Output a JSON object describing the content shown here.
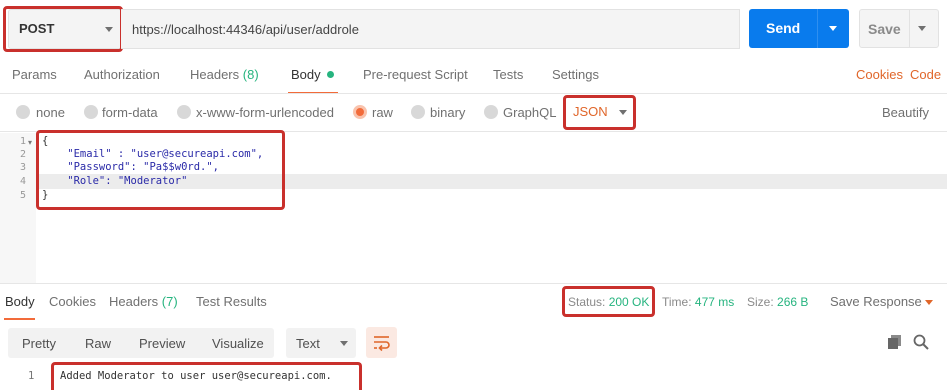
{
  "request": {
    "method": "POST",
    "url": "https://localhost:44346/api/user/addrole",
    "send_label": "Send",
    "save_label": "Save"
  },
  "request_tabs": {
    "params": "Params",
    "authorization": "Authorization",
    "headers": "Headers",
    "headers_count": "(8)",
    "body": "Body",
    "prerequest": "Pre-request Script",
    "tests": "Tests",
    "settings": "Settings",
    "cookies": "Cookies",
    "code": "Code"
  },
  "body_types": {
    "none": "none",
    "form_data": "form-data",
    "urlencoded": "x-www-form-urlencoded",
    "raw": "raw",
    "binary": "binary",
    "graphql": "GraphQL",
    "selected_format": "JSON",
    "beautify": "Beautify"
  },
  "editor": {
    "line_numbers": [
      "1",
      "2",
      "3",
      "4",
      "5"
    ],
    "lines": [
      "{",
      "    \"Email\" : \"user@secureapi.com\",",
      "    \"Password\": \"Pa$$w0rd.\",",
      "    \"Role\": \"Moderator\"",
      "}"
    ]
  },
  "response_tabs": {
    "body": "Body",
    "cookies": "Cookies",
    "headers": "Headers",
    "headers_count": "(7)",
    "test_results": "Test Results"
  },
  "response_meta": {
    "status_label": "Status:",
    "status_value": "200 OK",
    "time_label": "Time:",
    "time_value": "477 ms",
    "size_label": "Size:",
    "size_value": "266 B",
    "save_response": "Save Response"
  },
  "response_view": {
    "modes": [
      "Pretty",
      "Raw",
      "Preview",
      "Visualize"
    ],
    "selected_mode": "Pretty",
    "format": "Text",
    "line_number": "1",
    "body_text": "Added Moderator to user user@secureapi.com."
  },
  "colors": {
    "accent_orange": "#f26b3a",
    "send_blue": "#097bed",
    "success_green": "#26b47f",
    "highlight_red": "#c9302c"
  }
}
